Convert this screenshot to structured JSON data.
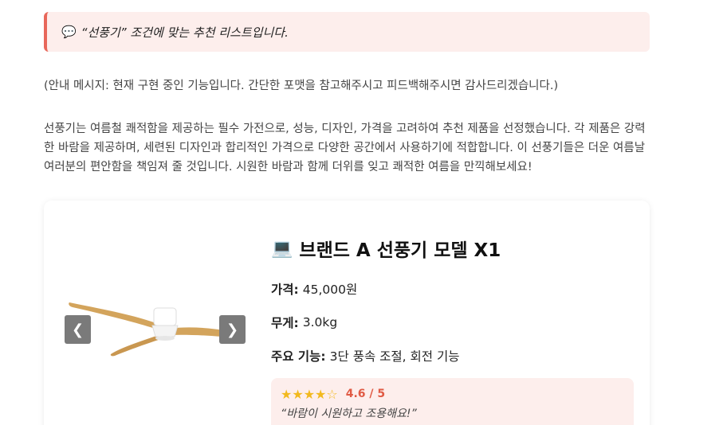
{
  "banner": {
    "icon": "speech-balloon-icon",
    "text": "“선풍기” 조건에 맞는 추천 리스트입니다."
  },
  "notice": "(안내 메시지: 현재 구현 중인 기능입니다. 간단한 포맷을 참고해주시고 피드백해주시면 감사드리겠습니다.)",
  "description": "선풍기는 여름철 쾌적함을 제공하는 필수 가전으로, 성능, 디자인, 가격을 고려하여 추천 제품을 선정했습니다. 각 제품은 강력한 바람을 제공하며, 세련된 디자인과 합리적인 가격으로 다양한 공간에서 사용하기에 적합합니다. 이 선풍기들은 더운 여름날 여러분의 편안함을 책임져 줄 것입니다. 시원한 바람과 함께 더위를 잊고 쾌적한 여름을 만끽해보세요!",
  "product": {
    "icon": "laptop-icon",
    "name": "브랜드 A 선풍기 모델 X1",
    "carousel": {
      "prev": "❮",
      "next": "❯"
    },
    "price_label": "가격:",
    "price": "45,000원",
    "weight_label": "무게:",
    "weight": "3.0kg",
    "features_label": "주요 기능:",
    "features": "3단 풍속 조절, 회전 기능",
    "review": {
      "stars_filled": "★★★★",
      "stars_empty": "☆",
      "rating": 4.6,
      "score": "4.6 / 5",
      "quote": "“바람이 시원하고 조용해요!”"
    }
  },
  "colors": {
    "accent": "#e8675a",
    "banner_bg": "#fdeeec",
    "star": "#f2b91e",
    "score": "#e05a44"
  }
}
